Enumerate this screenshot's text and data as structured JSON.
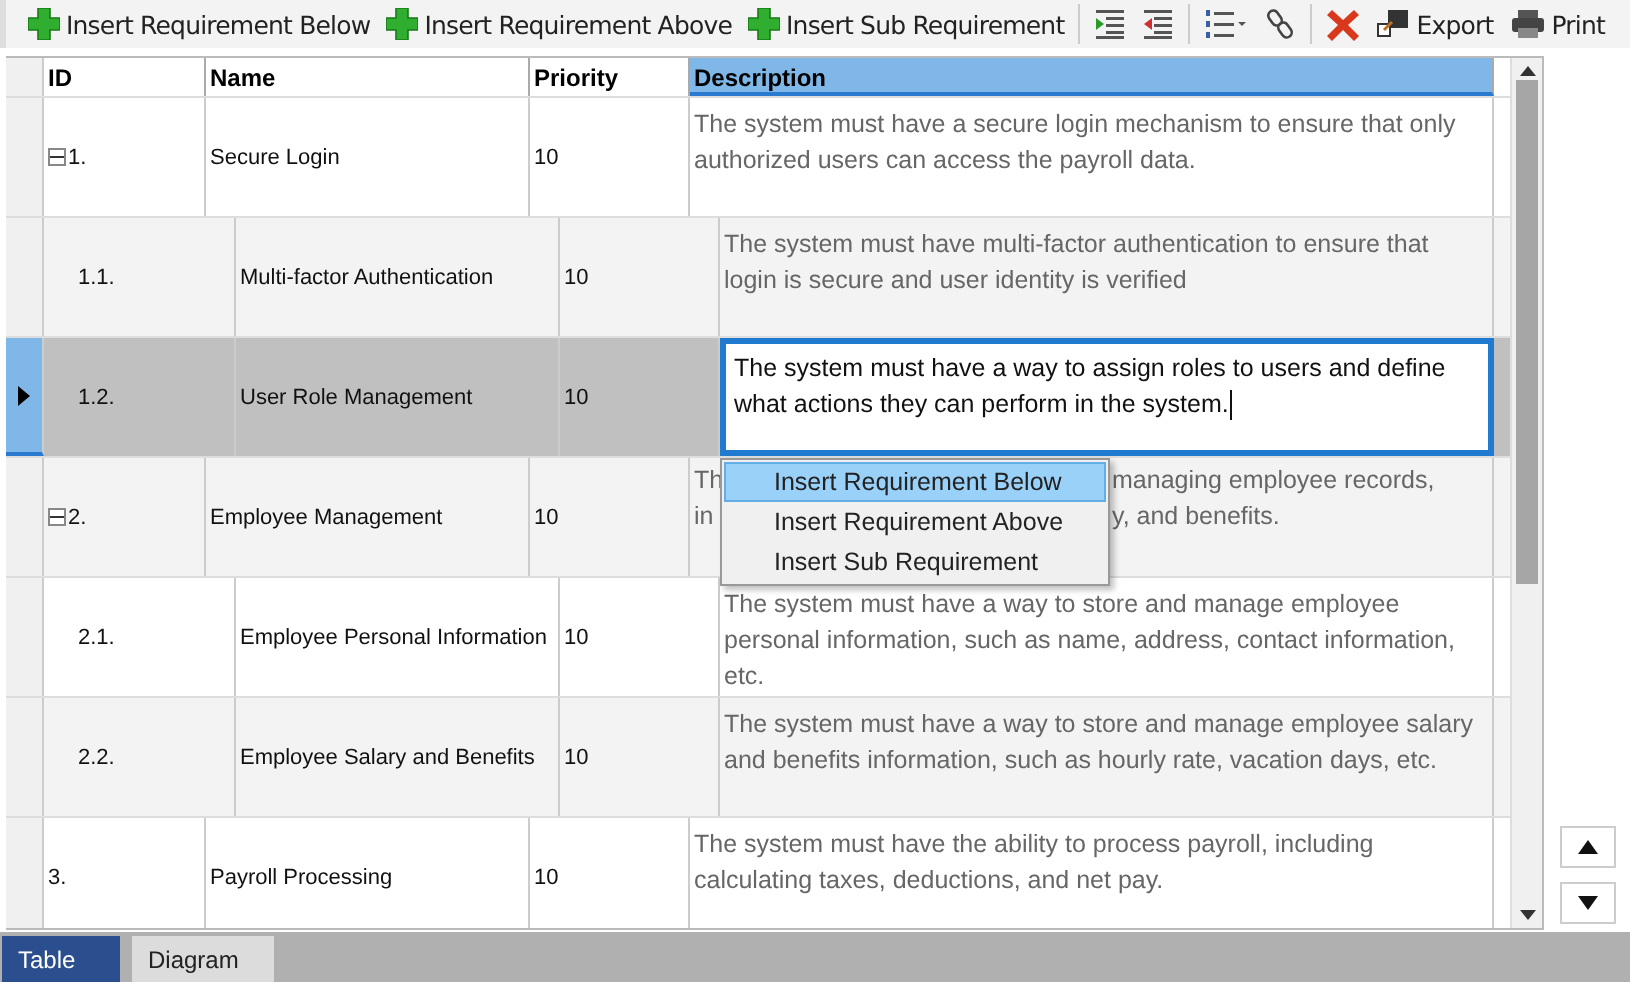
{
  "toolbar": {
    "groups": [
      [
        {
          "kind": "add",
          "label": "Insert Requirement Below"
        },
        {
          "kind": "add",
          "label": "Insert Requirement Above"
        },
        {
          "kind": "add",
          "label": "Insert Sub Requirement"
        }
      ],
      [
        {
          "kind": "indent"
        },
        {
          "kind": "outdent"
        }
      ],
      [
        {
          "kind": "numbering"
        },
        {
          "kind": "link"
        }
      ],
      [
        {
          "kind": "delete"
        },
        {
          "kind": "export",
          "label": "Export"
        },
        {
          "kind": "print",
          "label": "Print"
        }
      ]
    ]
  },
  "table": {
    "columns": [
      {
        "label": "ID",
        "selected": false
      },
      {
        "label": "Name",
        "selected": false
      },
      {
        "label": "Priority",
        "selected": false
      },
      {
        "label": "Description",
        "selected": true
      }
    ],
    "rows": [
      {
        "id": "1.",
        "name": "Secure Login",
        "priority": "10",
        "description": "The system must have a secure login mechanism to ensure that only authorized users can access the payroll data.",
        "selected": false,
        "editing": false,
        "expanded": true,
        "children": [
          {
            "id": "1.1.",
            "name": "Multi-factor Authentication",
            "priority": "10",
            "description": "The system must have multi-factor authentication to ensure that login is secure and user identity is verified",
            "selected": false,
            "editing": false
          },
          {
            "id": "1.2.",
            "name": "User Role Management",
            "priority": "10",
            "description": "The system must have a way to assign roles to users and define what actions they can perform in the system.",
            "selected": true,
            "editing": true
          }
        ]
      },
      {
        "id": "2.",
        "name": "Employee Management",
        "priority": "10",
        "description_parts": [
          {
            "left": "Th",
            "right": "managing employee records,"
          },
          {
            "left": "in",
            "right": "y, and benefits."
          }
        ],
        "selected": false,
        "editing": false,
        "expanded": true,
        "children": [
          {
            "id": "2.1.",
            "name": "Employee Personal Information",
            "priority": "10",
            "description": "The system must have a way to store and manage employee personal information, such as name, address, contact information, etc.",
            "selected": false,
            "editing": false
          },
          {
            "id": "2.2.",
            "name": "Employee Salary and Benefits",
            "priority": "10",
            "description": "The system must have a way to store and manage employee salary and benefits information, such as hourly rate, vacation days, etc.",
            "selected": false,
            "editing": false
          }
        ]
      },
      {
        "id": "3.",
        "name": "Payroll Processing",
        "priority": "10",
        "description": "The system must have the ability to process payroll, including calculating taxes, deductions, and net pay.",
        "selected": false,
        "editing": false
      }
    ]
  },
  "context_menu": {
    "items": [
      {
        "label": "Insert Requirement Below",
        "selected": true
      },
      {
        "label": "Insert Requirement Above",
        "selected": false
      },
      {
        "label": "Insert Sub Requirement",
        "selected": false
      }
    ]
  },
  "tabs": [
    {
      "label": "Table",
      "selected": true
    },
    {
      "label": "Diagram",
      "selected": false
    }
  ]
}
